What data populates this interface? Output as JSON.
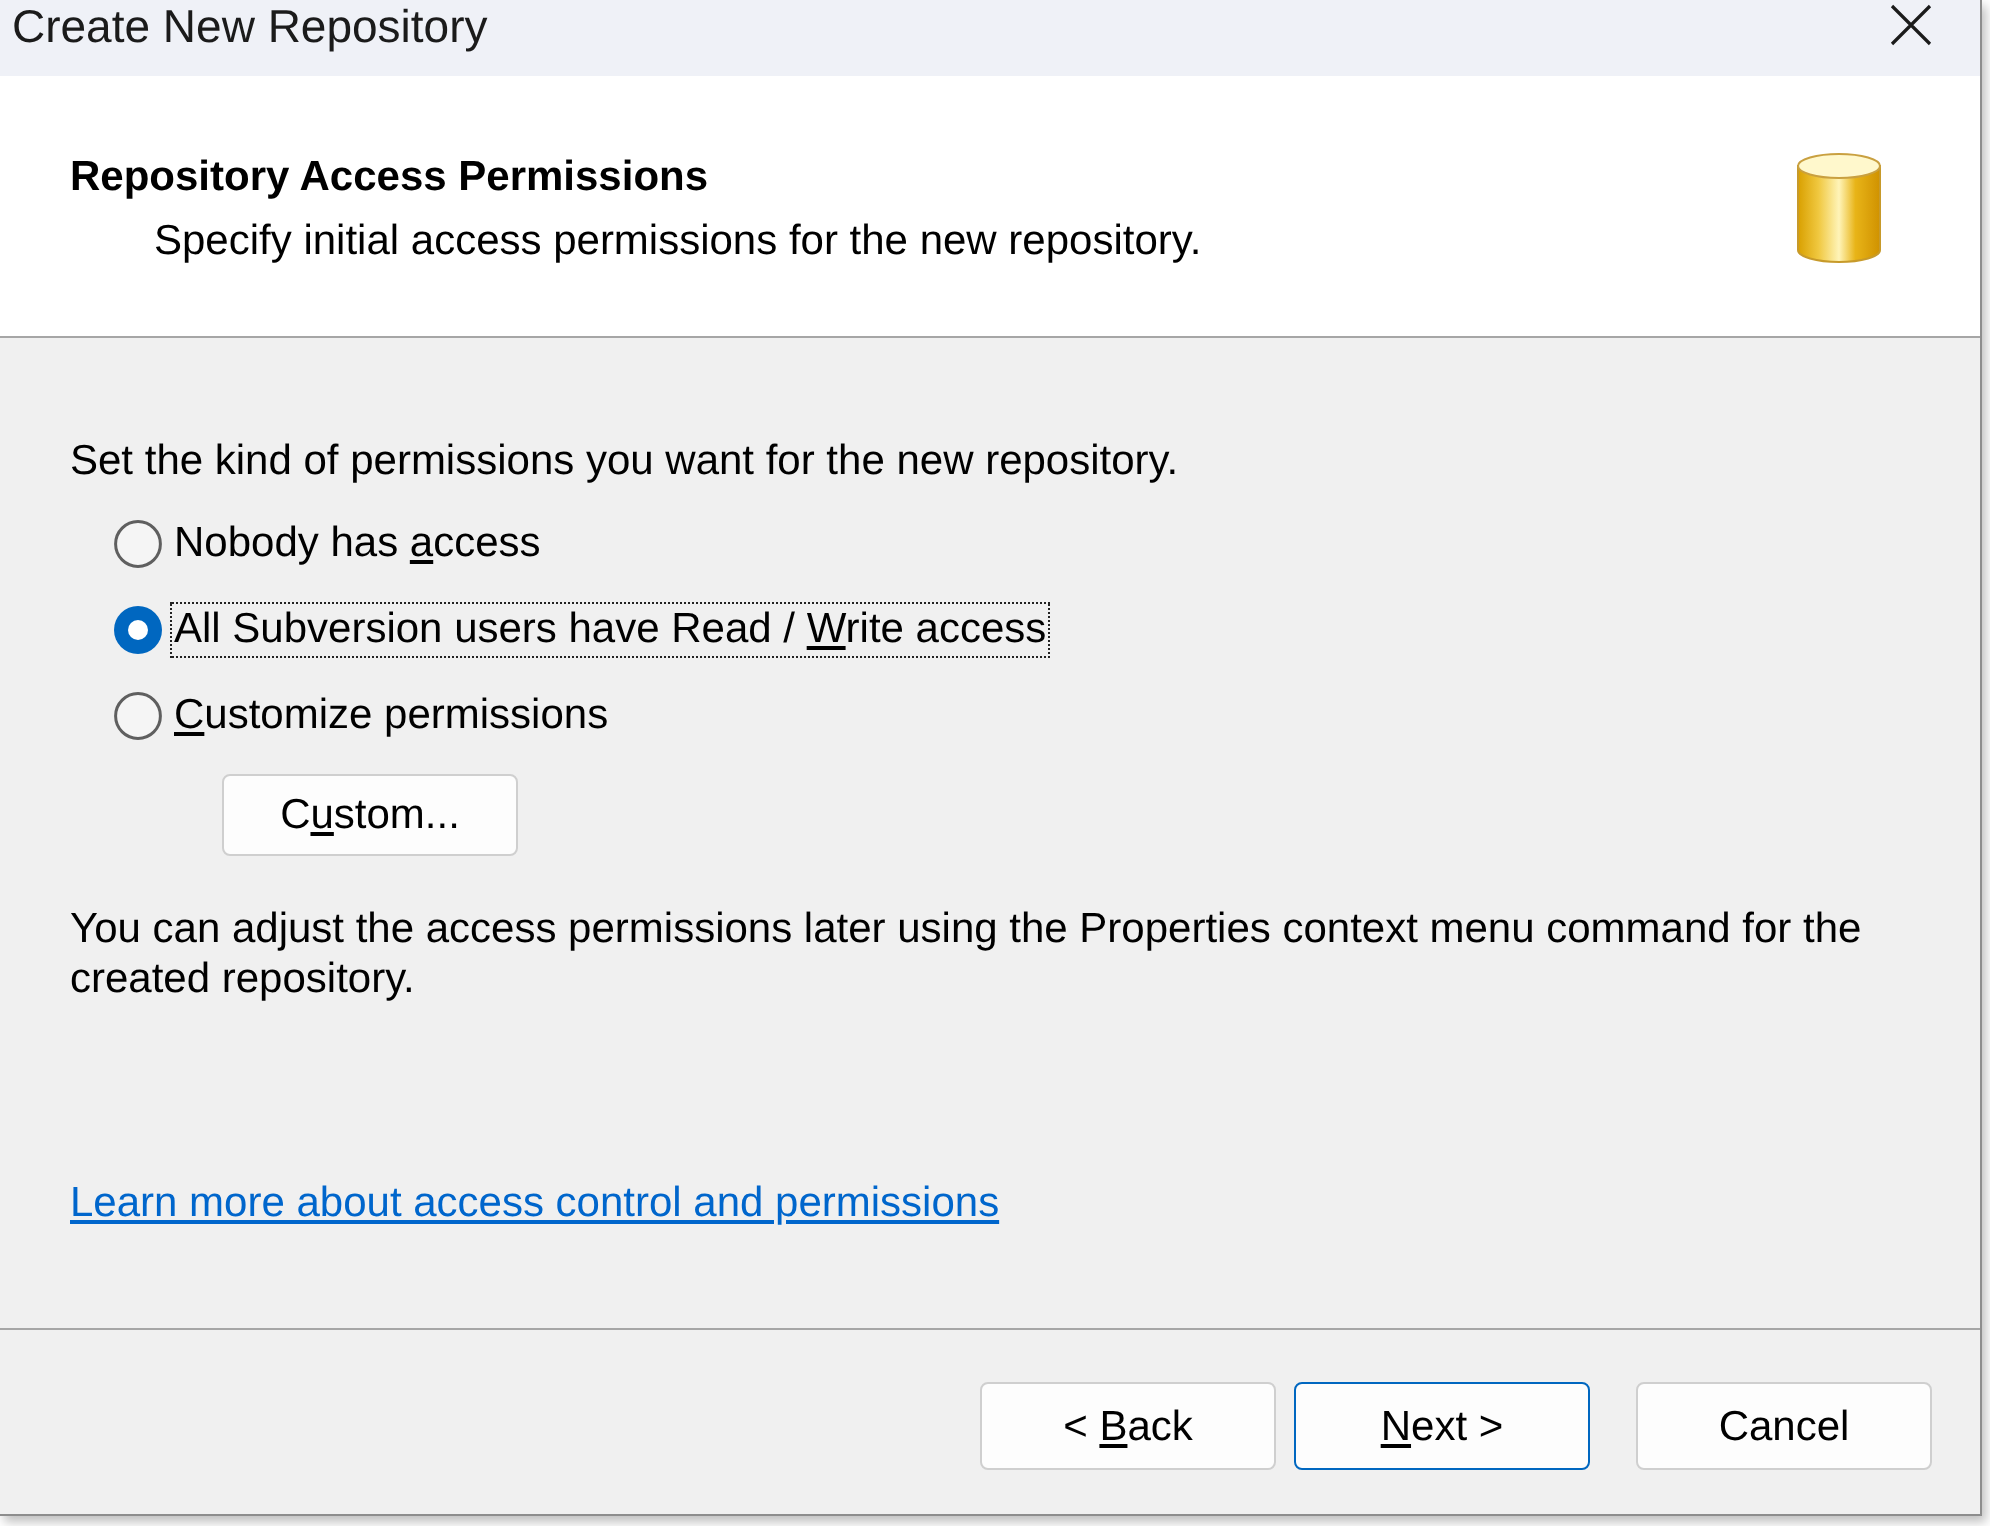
{
  "window": {
    "title": "Create New Repository"
  },
  "header": {
    "title": "Repository Access Permissions",
    "subtitle": "Specify initial access permissions for the new repository."
  },
  "intro": "Set the kind of permissions you want for the new repository.",
  "permission_options": [
    {
      "text_before": "Nobody has ",
      "mnemonic": "a",
      "text_after": "ccess",
      "selected": false,
      "focused": false
    },
    {
      "text_before": "All Subversion users have Read / ",
      "mnemonic": "W",
      "text_after": "rite access",
      "selected": true,
      "focused": true
    },
    {
      "mnemonic": "C",
      "text_after": "ustomize permissions",
      "selected": false,
      "focused": false
    }
  ],
  "custom_button": {
    "text_before": "C",
    "mnemonic": "u",
    "text_after": "stom..."
  },
  "note": "You can adjust the access permissions later using the Properties context menu command for the created repository.",
  "help_link": "Learn more about access control and permissions",
  "buttons": [
    {
      "text_before": "< ",
      "mnemonic": "B",
      "text_after": "ack",
      "default": false
    },
    {
      "mnemonic": "N",
      "text_after": "ext >",
      "default": true
    },
    {
      "label": "Cancel",
      "default": false
    }
  ]
}
